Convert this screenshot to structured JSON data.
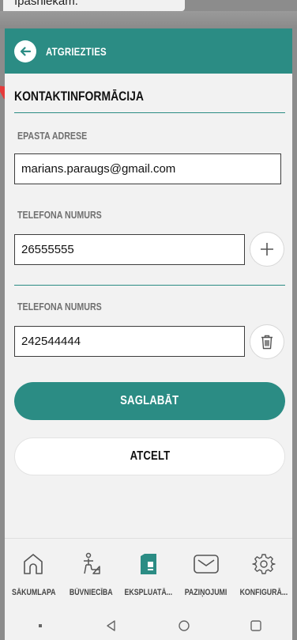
{
  "caption": "īpašniekam.",
  "header": {
    "back_label": "ATGRIEZTIES"
  },
  "section": {
    "title": "KONTAKTINFORMĀCIJA"
  },
  "email": {
    "label": "EPASTA ADRESE",
    "value": "marians.paraugs@gmail.com"
  },
  "phones": [
    {
      "label": "TELEFONA NUMURS",
      "value": "26555555",
      "action": "plus-icon"
    },
    {
      "label": "TELEFONA NUMURS",
      "value": "242544444",
      "action": "trash-icon"
    }
  ],
  "buttons": {
    "save": "SAGLABĀT",
    "cancel": "ATCELT"
  },
  "nav": [
    {
      "label": "SĀKUMLAPA",
      "icon": "home-icon"
    },
    {
      "label": "BŪVNIECĪBA",
      "icon": "construction-icon"
    },
    {
      "label": "EKSPLUATĀ...",
      "icon": "building-icon",
      "active": true
    },
    {
      "label": "PAZIŅOJUMI",
      "icon": "mail-icon"
    },
    {
      "label": "KONFIGURĀ...",
      "icon": "gear-icon"
    }
  ],
  "colors": {
    "accent": "#2b8c84",
    "background": "#f2f2f2",
    "warning_arrow": "#e53b3b"
  }
}
